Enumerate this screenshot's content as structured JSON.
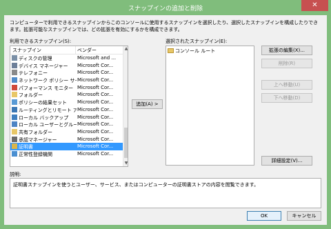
{
  "window": {
    "title": "スナップインの追加と削除",
    "close_glyph": "✕"
  },
  "description_text": "コンピューターで利用できるスナップインからこのコンソールに使用するスナップインを選択したり、選択したスナップインを構成したりできます。拡張可能なスナップインでは、どの拡張を有効にするかを構成できます。",
  "available": {
    "label": "利用できるスナップイン(S):",
    "col_snapin": "スナップイン",
    "col_vendor": "ベンダー",
    "items": [
      {
        "name": "ディスクの管理",
        "vendor": "Microsoft and ...",
        "icon": "disk-icon",
        "color": "#7a8fa6"
      },
      {
        "name": "デバイス マネージャー",
        "vendor": "Microsoft Cor...",
        "icon": "device-manager-icon",
        "color": "#6d7f99"
      },
      {
        "name": "テレフォニー",
        "vendor": "Microsoft Cor...",
        "icon": "telephony-icon",
        "color": "#8a8a8a"
      },
      {
        "name": "ネットワーク ポリシー サー...",
        "vendor": "Microsoft Cor...",
        "icon": "network-policy-icon",
        "color": "#4f8bc9"
      },
      {
        "name": "パフォーマンス モニター",
        "vendor": "Microsoft Cor...",
        "icon": "performance-icon",
        "color": "#d04a3a"
      },
      {
        "name": "フォルダー",
        "vendor": "Microsoft Cor...",
        "icon": "folder-icon",
        "color": "#e8c767"
      },
      {
        "name": "ポリシーの結果セット",
        "vendor": "Microsoft Cor...",
        "icon": "policy-result-icon",
        "color": "#5a9bd5"
      },
      {
        "name": "ルーティングとリモート アク...",
        "vendor": "Microsoft Cor...",
        "icon": "routing-icon",
        "color": "#3c78b4"
      },
      {
        "name": "ローカル バックアップ",
        "vendor": "Microsoft Cor...",
        "icon": "backup-icon",
        "color": "#3f7fbf"
      },
      {
        "name": "ローカル ユーザーとグループ",
        "vendor": "Microsoft Cor...",
        "icon": "users-icon",
        "color": "#4d84c4"
      },
      {
        "name": "共有フォルダー",
        "vendor": "Microsoft Cor...",
        "icon": "shared-folder-icon",
        "color": "#e8c767"
      },
      {
        "name": "承認マネージャー",
        "vendor": "Microsoft Cor...",
        "icon": "authorization-icon",
        "color": "#6a6a6a"
      },
      {
        "name": "証明書",
        "vendor": "Microsoft Cor...",
        "icon": "certificate-icon",
        "color": "#d9b54a",
        "selected": true
      },
      {
        "name": "正常性登録機関",
        "vendor": "Microsoft Cor...",
        "icon": "health-icon",
        "color": "#4a8fd1"
      }
    ]
  },
  "add_button": "追加(A) >",
  "selected": {
    "label": "選択されたスナップイン(E):",
    "root": "コンソール ルート"
  },
  "buttons": {
    "edit_extensions": "拡張の編集(X)...",
    "remove": "削除(R)",
    "move_up": "上へ移動(U)",
    "move_down": "下へ移動(D)",
    "advanced": "詳細設定(V)...",
    "ok": "OK",
    "cancel": "キャンセル"
  },
  "explanation": {
    "label": "説明:",
    "text": "証明書スナップインを使うとユーザー、サービス、またはコンピューターの証明書ストアの内容を閲覧できます。"
  }
}
